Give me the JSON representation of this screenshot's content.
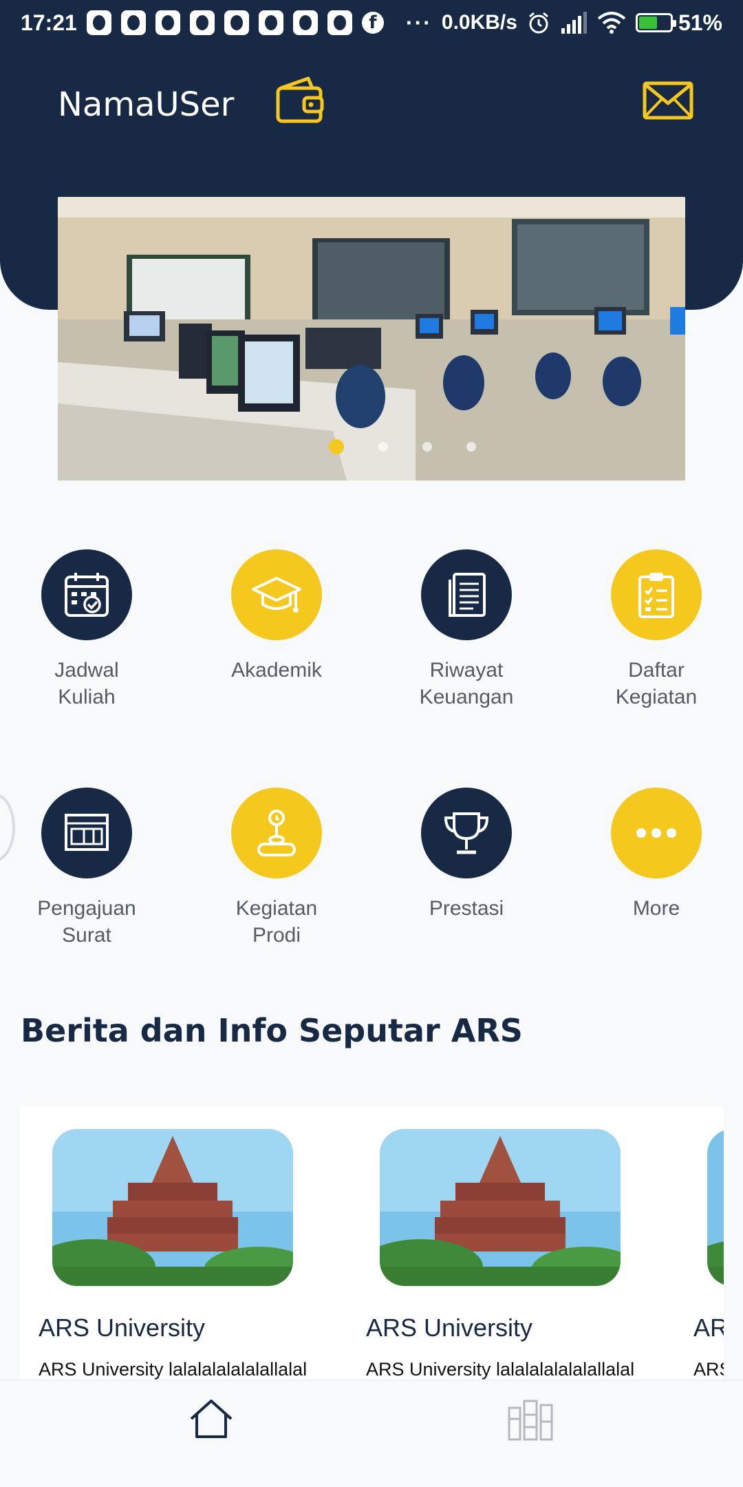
{
  "status_bar": {
    "time": "17:21",
    "net_speed": "0.0KB/s",
    "more": "···",
    "battery": "51%",
    "icons": [
      "notification-avatar-icon",
      "facebook-icon",
      "alarm-icon",
      "signal-icon",
      "wifi-icon",
      "battery-charging-icon"
    ]
  },
  "header": {
    "username": "NamaUSer",
    "wallet_icon": "wallet-icon",
    "mail_icon": "mail-icon"
  },
  "banner": {
    "slides": 4,
    "active_index": 0
  },
  "menu": [
    {
      "label": "Jadwal\nKuliah",
      "icon": "calendar-check-icon",
      "color": "#172944"
    },
    {
      "label": "Akademik",
      "icon": "graduation-cap-icon",
      "color": "#f5c81e"
    },
    {
      "label": "Riwayat\nKeuangan",
      "icon": "document-list-icon",
      "color": "#172944"
    },
    {
      "label": "Daftar\nKegiatan",
      "icon": "clipboard-checklist-icon",
      "color": "#f5c81e"
    },
    {
      "label": "Pengajuan\nSurat",
      "icon": "form-letter-icon",
      "color": "#172944"
    },
    {
      "label": "Kegiatan\nProdi",
      "icon": "joystick-icon",
      "color": "#f5c81e"
    },
    {
      "label": "Prestasi",
      "icon": "trophy-icon",
      "color": "#172944"
    },
    {
      "label": "More",
      "icon": "more-dots-icon",
      "color": "#f5c81e"
    }
  ],
  "news": {
    "section_title": "Berita dan Info Seputar ARS",
    "items": [
      {
        "title": "ARS University",
        "desc": "ARS University lalalalalalalallalal"
      },
      {
        "title": "ARS University",
        "desc": "ARS University lalalalalalalallalal"
      },
      {
        "title": "ARS University",
        "desc": "ARS University lalalalalalalallalal"
      }
    ]
  },
  "bottom_nav": {
    "items": [
      {
        "icon": "home-icon",
        "active": true
      },
      {
        "icon": "building-icon",
        "active": false
      }
    ]
  },
  "colors": {
    "navy": "#172944",
    "yellow": "#f5c81e",
    "background": "#f8f9fb"
  }
}
